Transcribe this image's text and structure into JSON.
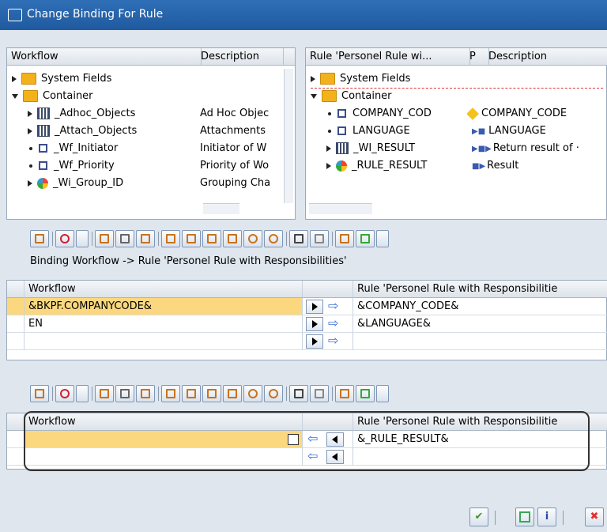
{
  "window": {
    "title": "Change Binding For Rule"
  },
  "left_tree": {
    "columns": [
      "Workflow",
      "Description"
    ],
    "rows": [
      {
        "name": "System Fields",
        "desc": "",
        "icon": "folder-icon",
        "node": "collapsed"
      },
      {
        "name": "Container",
        "desc": "",
        "icon": "folder-open-icon",
        "node": "expanded"
      },
      {
        "name": "_Adhoc_Objects",
        "desc": "Ad Hoc Objec",
        "icon": "table-icon",
        "node": "collapsed"
      },
      {
        "name": "_Attach_Objects",
        "desc": "Attachments",
        "icon": "table-icon",
        "node": "collapsed"
      },
      {
        "name": "_Wf_Initiator",
        "desc": "Initiator of W",
        "icon": "element-icon",
        "node": "leaf"
      },
      {
        "name": "_Wf_Priority",
        "desc": "Priority of Wo",
        "icon": "element-icon",
        "node": "leaf"
      },
      {
        "name": "_Wi_Group_ID",
        "desc": "Grouping Cha",
        "icon": "group-icon",
        "node": "collapsed"
      }
    ]
  },
  "right_tree": {
    "columns": [
      "Rule 'Personel Rule wi...",
      "P",
      "Description"
    ],
    "rows": [
      {
        "name": "System Fields",
        "desc": "",
        "icon": "folder-icon",
        "node": "collapsed"
      },
      {
        "name": "Container",
        "desc": "",
        "icon": "folder-open-icon",
        "node": "expanded"
      },
      {
        "name": "COMPANY_COD",
        "desc": "COMPANY_CODE",
        "icon": "element-icon",
        "node": "leaf"
      },
      {
        "name": "LANGUAGE",
        "desc": "LANGUAGE",
        "icon": "element-icon",
        "node": "leaf"
      },
      {
        "name": "_WI_RESULT",
        "desc": "Return result of ·",
        "icon": "table-icon",
        "node": "collapsed"
      },
      {
        "name": "_RULE_RESULT",
        "desc": "Result",
        "icon": "group-icon",
        "node": "collapsed"
      }
    ]
  },
  "binding_label": "Binding Workflow  -> Rule 'Personel Rule with Responsibilities'",
  "grid1": {
    "left_header": "Workflow",
    "right_header": "Rule 'Personel Rule with Responsibilitie",
    "rows": [
      {
        "left": "&BKPF.COMPANYCODE&",
        "right": "&COMPANY_CODE&"
      },
      {
        "left": "EN",
        "right": "&LANGUAGE&"
      },
      {
        "left": "",
        "right": ""
      }
    ]
  },
  "grid2": {
    "left_header": "Workflow",
    "right_header": "Rule 'Personel Rule with Responsibilitie",
    "rows": [
      {
        "left": "",
        "right": "&_RULE_RESULT&"
      },
      {
        "left": "",
        "right": ""
      }
    ]
  },
  "toolbar_icons": [
    "workflow-icon",
    "bind-icon",
    "details-icon",
    "cut-icon",
    "copy-icon",
    "new-icon",
    "insert-row-icon",
    "delete-row-icon",
    "paste-icon",
    "undo-icon",
    "redo-icon",
    "find-icon",
    "find-next-icon",
    "print-icon",
    "export-icon"
  ],
  "footer": {
    "ok": "✔",
    "cancel": "✖"
  }
}
